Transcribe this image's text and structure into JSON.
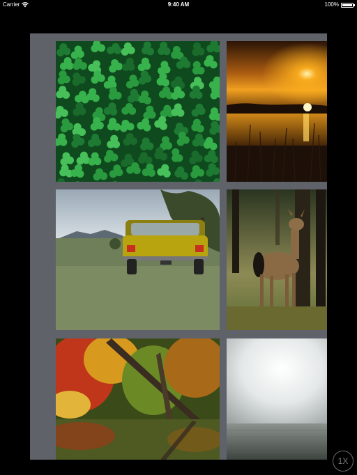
{
  "status_bar": {
    "carrier": "Carrier",
    "time": "9:40 AM",
    "battery": "100%",
    "battery_level": 1.0
  },
  "gallery": {
    "photos": [
      {
        "name": "clover-leaves"
      },
      {
        "name": "sunset-over-lake"
      },
      {
        "name": "yellow-mustang-car"
      },
      {
        "name": "deer-in-forest"
      },
      {
        "name": "autumn-tree-reflection"
      },
      {
        "name": "foggy-field"
      }
    ]
  },
  "scale_button": {
    "label": "1X"
  },
  "colors": {
    "panel": "#60626a",
    "background": "#000000"
  }
}
